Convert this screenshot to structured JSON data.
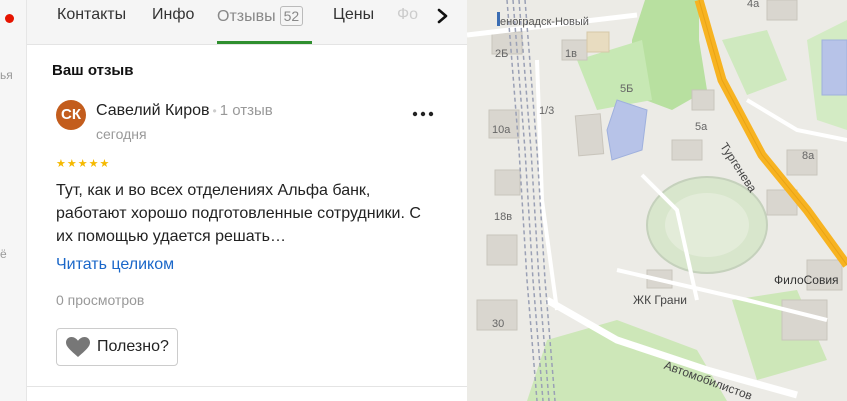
{
  "left_strip": {
    "text_1": "ья",
    "text_2": "ё"
  },
  "tabs": [
    {
      "label": "Контакты"
    },
    {
      "label": "Инфо"
    },
    {
      "label": "Отзывы",
      "badge": "52",
      "active": true
    },
    {
      "label": "Цены"
    },
    {
      "label": "Фо"
    }
  ],
  "section_title": "Ваш отзыв",
  "review": {
    "avatar_initials": "СК",
    "avatar_color": "#c35d1d",
    "author": "Савелий Киров",
    "author_review_count": "1 отзыв",
    "date": "сегодня",
    "rating": 5,
    "stars": "★★★★★",
    "text": "Тут, как и во всех отделениях Альфа банк, работают хорошо подготовленные сотрудники. С их помощью удается решать…",
    "read_more": "Читать целиком",
    "views": "0 просмотров",
    "useful_label": "Полезно?"
  },
  "map": {
    "labels": {
      "station": "еноградск-Новый",
      "b4a": "4а",
      "b2b": "2Б",
      "b1v": "1в",
      "b5b": "5Б",
      "b1_3": "1/3",
      "b10a": "10а",
      "b5a": "5а",
      "b8a": "8а",
      "b18v": "18в",
      "b30": "30",
      "street_turgeneva": "Тургенева",
      "street_avtomobilistov": "Автомобилистов",
      "place_zhk": "ЖК Грани",
      "place_filo": "ФилоСовия"
    }
  },
  "colors": {
    "accent_green": "#2f8f2f",
    "link": "#1a67c9",
    "star": "#f5b900",
    "road": "#f7b321"
  }
}
